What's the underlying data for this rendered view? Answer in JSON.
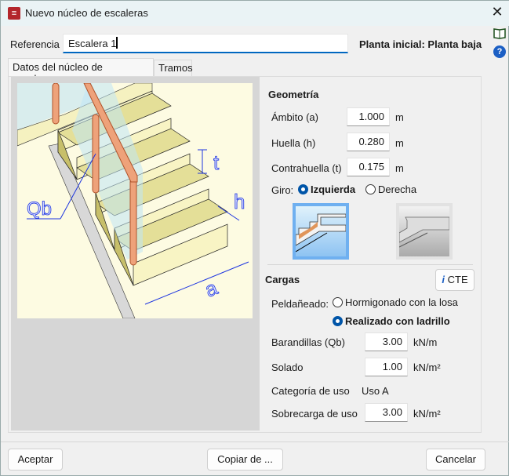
{
  "window": {
    "title": "Nuevo núcleo de escaleras",
    "close_icon": "close-icon"
  },
  "header": {
    "reference_label": "Referencia",
    "reference_value": "Escalera 1",
    "planta": "Planta inicial: Planta baja"
  },
  "tabs": [
    {
      "label": "Datos del núcleo de escaleras",
      "active": true
    },
    {
      "label": "Tramos",
      "active": false
    }
  ],
  "illustration": {
    "labels": {
      "t": "t",
      "h": "h",
      "a": "a",
      "qb": "Qb"
    }
  },
  "geometria": {
    "title": "Geometría",
    "fields": [
      {
        "label": "Ámbito (a)",
        "value": "1.000",
        "unit": "m"
      },
      {
        "label": "Huella (h)",
        "value": "0.280",
        "unit": "m"
      },
      {
        "label": "Contrahuella (t)",
        "value": "0.175",
        "unit": "m"
      }
    ],
    "giro_label": "Giro:",
    "giro_options": [
      {
        "label": "Izquierda",
        "selected": true
      },
      {
        "label": "Derecha",
        "selected": false
      }
    ]
  },
  "cargas": {
    "title": "Cargas",
    "cte_button": "CTE",
    "peldaneado_label": "Peldañeado:",
    "peldaneado_options": [
      {
        "label": "Hormigonado con la losa",
        "selected": false
      },
      {
        "label": "Realizado con ladrillo",
        "selected": true
      }
    ],
    "barandillas": {
      "label": "Barandillas (Qb)",
      "value": "3.00",
      "unit": "kN/m"
    },
    "solado": {
      "label": "Solado",
      "value": "1.00",
      "unit": "kN/m²"
    },
    "categoria": {
      "label": "Categoría de uso",
      "value": "Uso A"
    },
    "sobrecarga": {
      "label": "Sobrecarga de uso",
      "value": "3.00",
      "unit": "kN/m²"
    }
  },
  "footer": {
    "accept": "Aceptar",
    "copy": "Copiar de ...",
    "cancel": "Cancelar"
  },
  "colors": {
    "accent": "#0067c0",
    "selected_border": "#6fb0f0"
  }
}
